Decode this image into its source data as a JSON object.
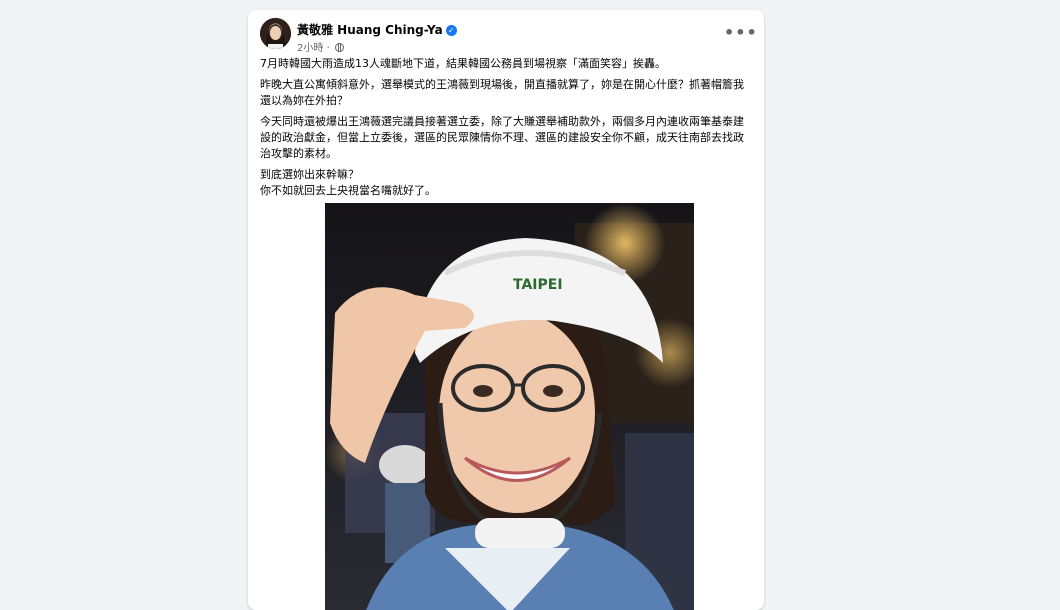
{
  "post": {
    "author_name": "黃敬雅 Huang Ching-Ya",
    "timestamp": "2小時",
    "privacy_icon": "globe-icon",
    "more_icon": "more-options-icon",
    "more_label": "•••",
    "paragraphs": [
      "7月時韓國大雨造成13人魂斷地下道，結果韓國公務員到場視察「滿面笑容」挨轟。",
      "昨晚大直公寓傾斜意外，選舉模式的王鴻薇到現場後，開直播就算了，妳是在開心什麼？抓著帽簷我還以為妳在外拍？",
      "今天同時還被爆出王鴻薇選完議員接著選立委，除了大賺選舉補助款外，兩個多月內連收兩筆基泰建設的政治獻金，但當上立委後，選區的民眾陳情你不理、選區的建設安全你不顧，成天往南部去找政治攻擊的素材。",
      "到底選妳出來幹嘛？",
      "你不如就回去上央視當名嘴就好了。"
    ],
    "helmet_text": "TAIPEI"
  },
  "colors": {
    "background": "#f0f2f5",
    "card": "#ffffff",
    "verified": "#1877f2",
    "secondary_text": "#65676b"
  }
}
